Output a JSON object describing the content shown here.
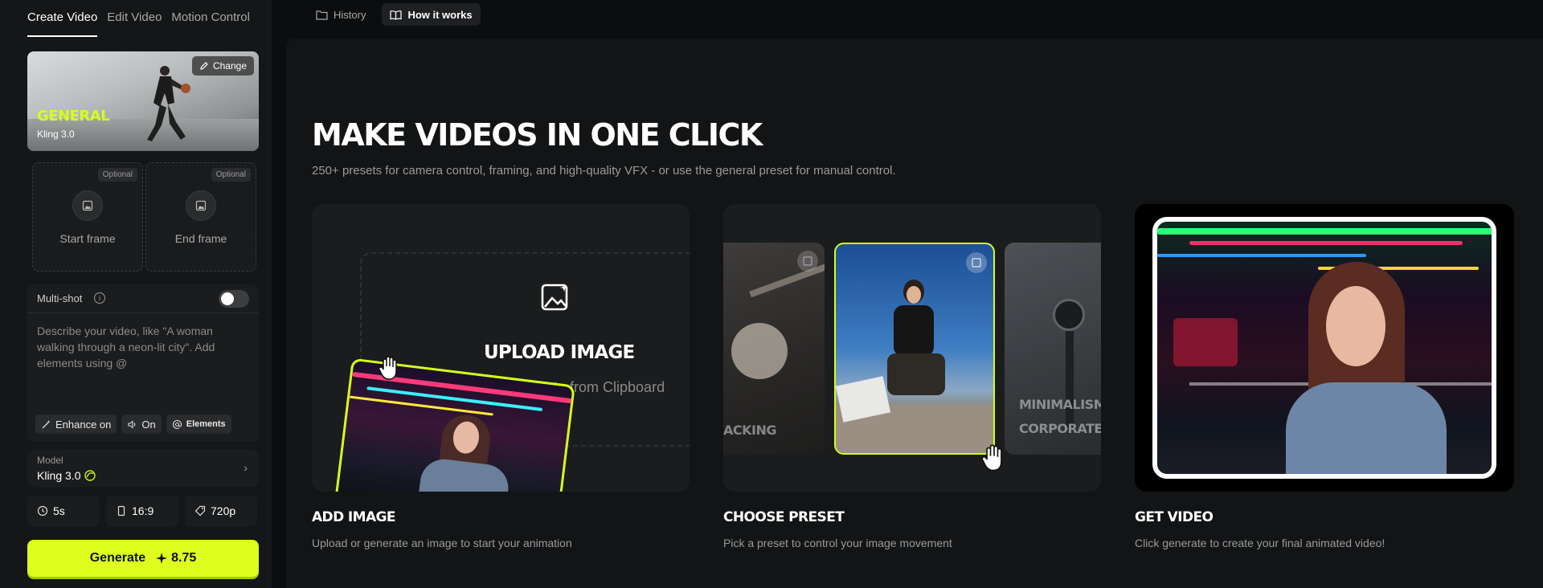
{
  "left_panel": {
    "tabs": [
      "Create Video",
      "Edit Video",
      "Motion Control"
    ],
    "preset": {
      "change_label": "Change",
      "name": "GENERAL",
      "model": "Kling 3.0"
    },
    "start_frame": {
      "optional": "Optional",
      "label": "Start frame"
    },
    "end_frame": {
      "optional": "Optional",
      "label": "End frame"
    },
    "multishot": {
      "label": "Multi-shot",
      "info": "i",
      "enabled": false
    },
    "prompt_placeholder": "Describe your video, like \"A woman walking through a neon-lit city\". Add elements using @",
    "chips": {
      "enhance": "Enhance on",
      "sound": "On",
      "elements": "Elements"
    },
    "model": {
      "label": "Model",
      "value": "Kling 3.0"
    },
    "duration": "5s",
    "aspect": "16:9",
    "resolution": "720p",
    "generate": {
      "label": "Generate",
      "cost": "8.75"
    }
  },
  "top_nav": {
    "history": "History",
    "how_it_works": "How it works"
  },
  "main": {
    "headline": "MAKE VIDEOS IN ONE CLICK",
    "subline": "250+ presets for camera control, framing, and high-quality VFX - or use the general preset for manual control.",
    "steps": [
      {
        "title": "ADD IMAGE",
        "desc": "Upload or generate an image to start your animation",
        "upload_title": "UPLOAD IMAGE",
        "paste": "Paste from Clipboard"
      },
      {
        "title": "CHOOSE PRESET",
        "desc": "Pick a preset to control your image movement",
        "left_label": "ACKING",
        "right_label_1": "MINIMALISM",
        "right_label_2": "CORPORATE"
      },
      {
        "title": "GET VIDEO",
        "desc": "Click generate to create your final animated video!"
      }
    ]
  },
  "colors": {
    "accent": "#dcff1e",
    "background": "#0c0d0e",
    "panel": "#151617"
  }
}
